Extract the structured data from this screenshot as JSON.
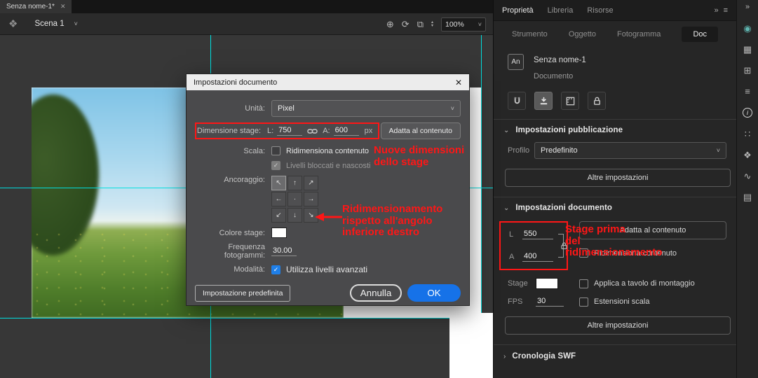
{
  "tab_bar": {
    "document_tab": "Senza nome-1*"
  },
  "toolbar": {
    "scene_label": "Scena 1",
    "zoom_value": "100%"
  },
  "icons": {
    "close": "✕",
    "chevron_down": "˅",
    "section_open": "⌄",
    "section_closed": "›",
    "menu": "≡",
    "more": "»",
    "app": "❖",
    "center_stage": "⊕",
    "loop": "⟳",
    "clip": "⧉",
    "spin_up": "▴",
    "spin_down": "▾",
    "check": "✓",
    "info": "i"
  },
  "colors": {
    "annotation_red": "#ff1616",
    "accent_blue": "#1672e8",
    "guide_cyan": "#00dfe0"
  },
  "dialog": {
    "title": "Impostazioni documento",
    "unit_label": "Unità:",
    "unit_value": "Pixel",
    "size_label": "Dimensione stage:",
    "w_label": "L:",
    "w_value": "750",
    "h_label": "A:",
    "h_value": "600",
    "px_label": "px",
    "fit_button": "Adatta al contenuto",
    "scale_label": "Scala:",
    "scale_option": "Ridimensiona contenuto",
    "locked_option": "Livelli bloccati e nascosti",
    "anchor_label": "Ancoraggio:",
    "anchor_cells": [
      "↖",
      "↑",
      "↗",
      "←",
      "·",
      "→",
      "↙",
      "↓",
      "↘"
    ],
    "stage_color_label": "Colore stage:",
    "framerate_label": "Frequenza fotogrammi:",
    "framerate_value": "30.00",
    "mode_label": "Modalità:",
    "mode_option": "Utilizza livelli avanzati",
    "default_button": "Impostazione predefinita",
    "cancel_button": "Annulla",
    "ok_button": "OK"
  },
  "annotations": {
    "new_size_line1": "Nuove dimensioni",
    "new_size_line2": "dello stage",
    "corner_line1": "Ridimensionamento",
    "corner_line2": "rispetto all'angolo",
    "corner_line3": "inferiore destro",
    "before_line1": "Stage prima",
    "before_line2": "del",
    "before_line3": "ridimensionamento"
  },
  "panel": {
    "tabs": [
      {
        "label": "Proprietà"
      },
      {
        "label": "Libreria"
      },
      {
        "label": "Risorse"
      }
    ],
    "subtabs": [
      {
        "label": "Strumento"
      },
      {
        "label": "Oggetto"
      },
      {
        "label": "Fotogramma"
      },
      {
        "label": "Doc"
      }
    ],
    "doc_badge": "An",
    "doc_name": "Senza nome-1",
    "doc_kind": "Documento",
    "publish": {
      "title": "Impostazioni pubblicazione",
      "profile_label": "Profilo",
      "profile_value": "Predefinito",
      "more_button": "Altre impostazioni"
    },
    "docset": {
      "title": "Impostazioni documento",
      "w_label": "L",
      "w_value": "550",
      "h_label": "A",
      "h_value": "400",
      "fit_button": "Adatta al contenuto",
      "resize_option": "Ridimensiona contenuto",
      "stage_label": "Stage",
      "apply_option": "Applica a tavolo di montaggio",
      "fps_label": "FPS",
      "fps_value": "30",
      "scale_option": "Estensioni scala",
      "more_button": "Altre impostazioni"
    },
    "swf": {
      "title": "Cronologia SWF"
    }
  }
}
